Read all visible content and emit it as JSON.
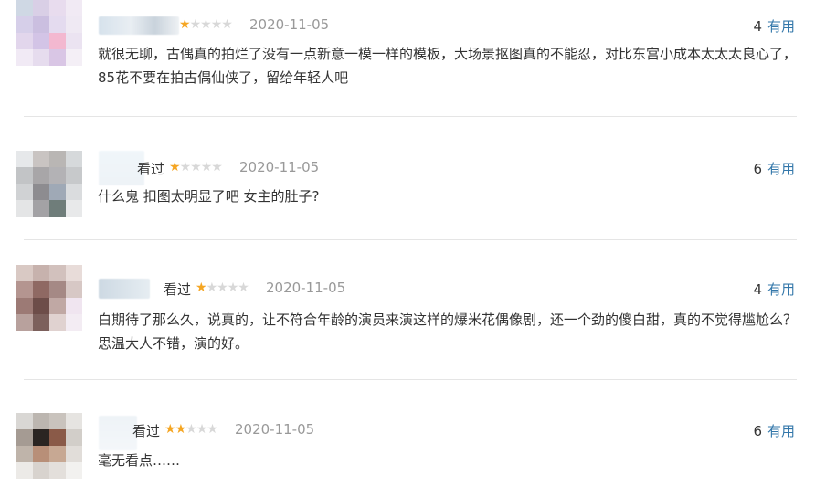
{
  "reviews": [
    {
      "watched": "",
      "rating": 1,
      "date": "2020-11-05",
      "useful_count": "4",
      "useful_label": "有用",
      "text": "就很无聊，古偶真的拍烂了没有一点新意一模一样的模板，大场景抠图真的不能忍，对比东宫小成本太太太良心了，85花不要在拍古偶仙侠了，留给年轻人吧"
    },
    {
      "watched": "看过",
      "rating": 1,
      "date": "2020-11-05",
      "useful_count": "6",
      "useful_label": "有用",
      "text": "什么鬼 扣图太明显了吧 女主的肚子?"
    },
    {
      "watched": "看过",
      "rating": 1,
      "date": "2020-11-05",
      "useful_count": "4",
      "useful_label": "有用",
      "text": "白期待了那么久，说真的，让不符合年龄的演员来演这样的爆米花偶像剧，还一个劲的傻白甜，真的不觉得尴尬么？思温大人不错，演的好。"
    },
    {
      "watched": "看过",
      "rating": 2,
      "date": "2020-11-05",
      "useful_count": "6",
      "useful_label": "有用",
      "text": "毫无看点……"
    }
  ],
  "colors": {
    "link": "#3377aa",
    "star_on": "#f5a623",
    "star_off": "#d8d8d8",
    "date": "#999999",
    "text": "#333333"
  }
}
